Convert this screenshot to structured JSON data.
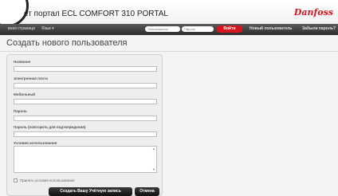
{
  "header": {
    "portal_title": "ет портал ECL COMFORT 310 PORTAL",
    "brand": "Danfoss"
  },
  "nav": {
    "home": "вная страница",
    "language": "Язык ▾",
    "username_placeholder": "Пользователь",
    "password_placeholder": "Пароль",
    "login_button": "Войти",
    "new_user": "Новый пользователь",
    "forgot_password": "Забыли пароль?"
  },
  "page": {
    "title": "Создать нового пользователя"
  },
  "form": {
    "fields": {
      "name_label": "Название",
      "email_label": "Электронная почта",
      "mobile_label": "Мобильный",
      "password_label": "Пароль",
      "password_confirm_label": "Пароль (повторить для подтверждения)",
      "terms_label": "Условия использования"
    },
    "accept_terms": "Принять условия использования",
    "accept_checked": false,
    "create_button": "Создать Вашу Учётную запись",
    "cancel_button": "Отмена"
  }
}
